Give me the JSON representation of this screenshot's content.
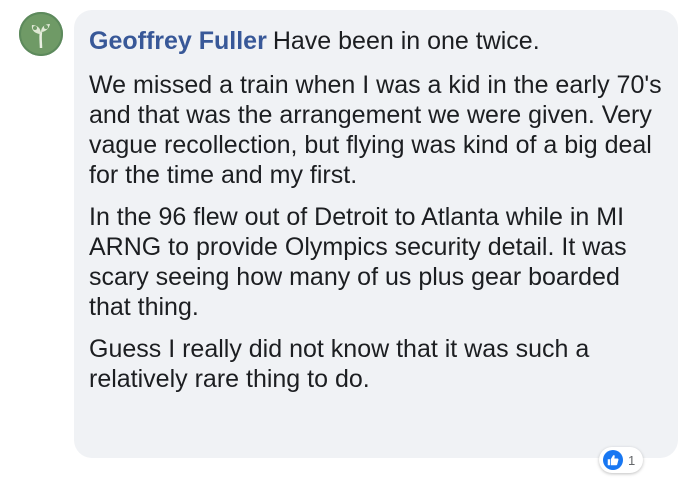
{
  "comment": {
    "author": "Geoffrey Fuller",
    "first_line": "Have been in one twice.",
    "paragraphs": [
      "We missed a train when I was a kid in the early 70's and that was the arrangement we were given. Very vague recollection, but flying was kind of a big deal for the time and my first.",
      "In the 96 flew out of Detroit to Atlanta while in MI ARNG to provide Olympics security detail. It was scary seeing how many of us plus gear boarded that thing.",
      "Guess I really did not know that it was such a relatively rare thing to do."
    ],
    "reaction": {
      "icon": "thumbs-up-icon",
      "count": "1",
      "color": "#1877f2"
    }
  },
  "colors": {
    "author": "#385898",
    "bubble": "#f0f2f5",
    "text": "#1c1e21"
  }
}
